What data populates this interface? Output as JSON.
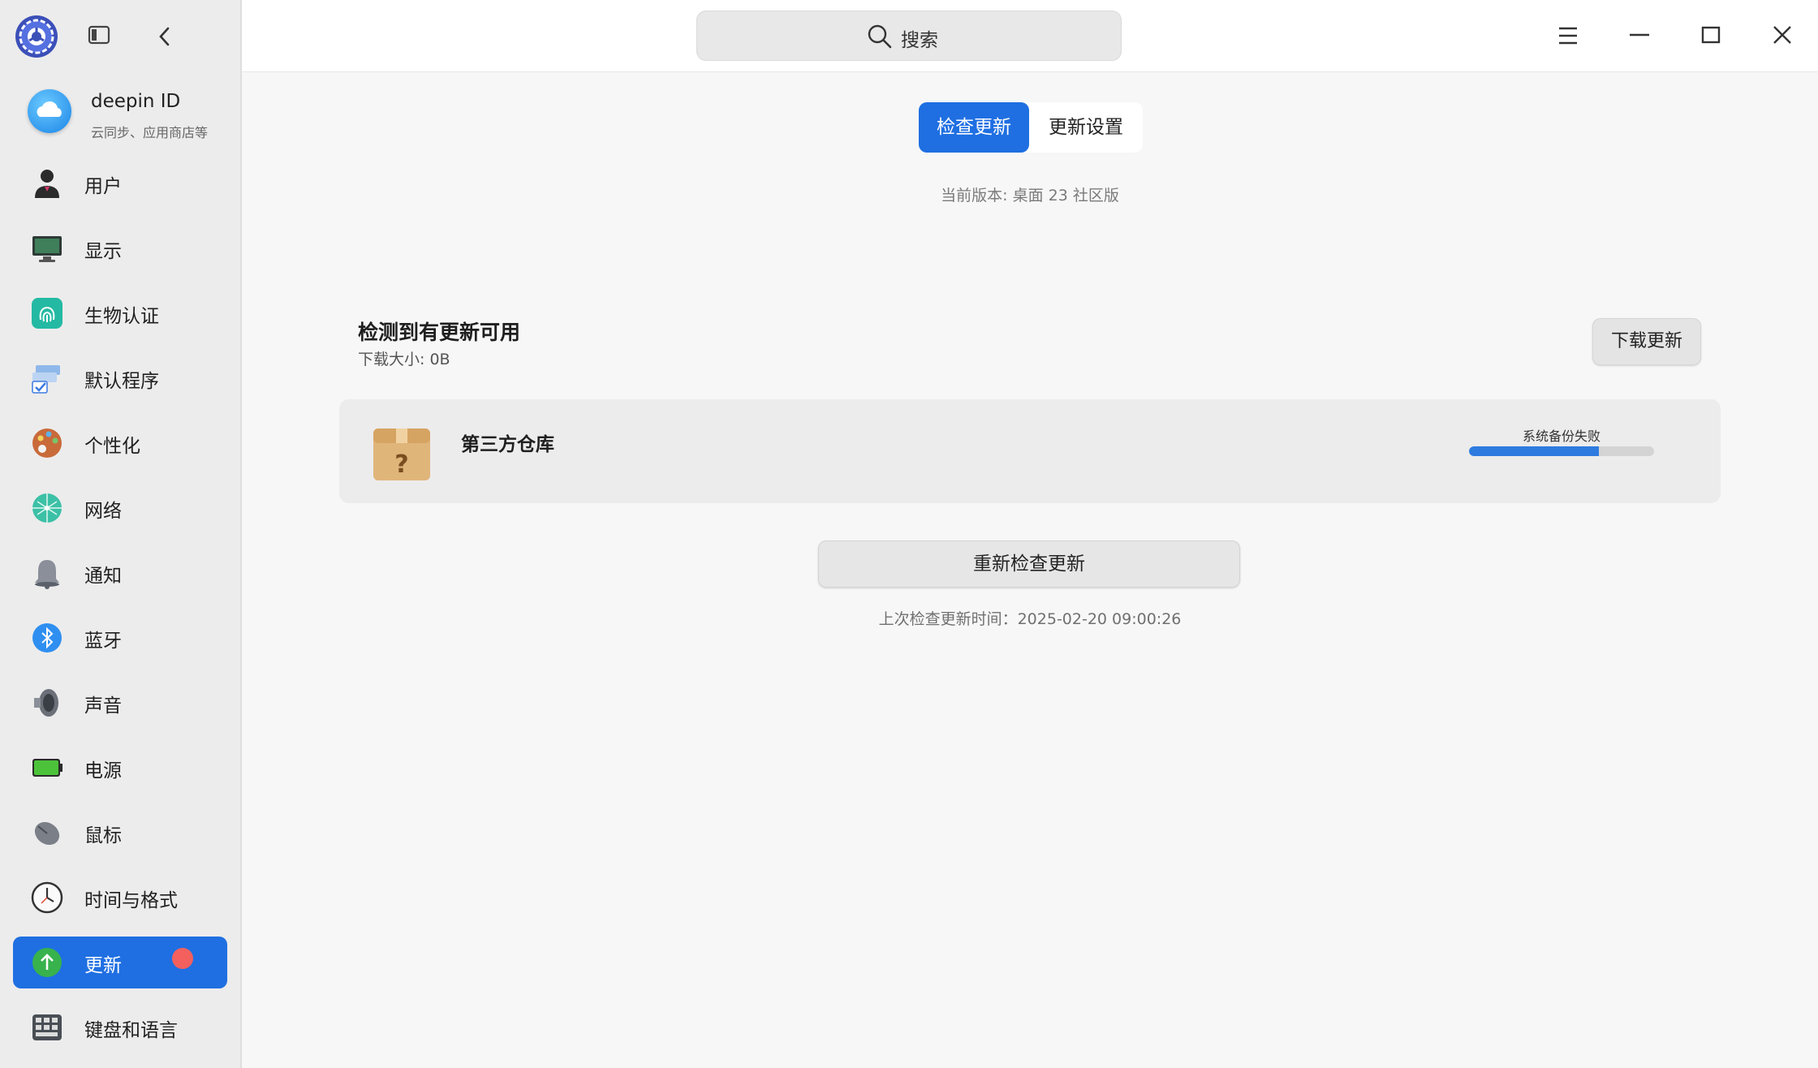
{
  "sidebar": {
    "account": {
      "name": "deepin ID",
      "subtitle": "云同步、应用商店等"
    },
    "items": [
      {
        "label": "用户",
        "icon": "user-icon"
      },
      {
        "label": "显示",
        "icon": "display-icon"
      },
      {
        "label": "生物认证",
        "icon": "fingerprint-icon"
      },
      {
        "label": "默认程序",
        "icon": "default-apps-icon"
      },
      {
        "label": "个性化",
        "icon": "palette-icon"
      },
      {
        "label": "网络",
        "icon": "network-icon"
      },
      {
        "label": "通知",
        "icon": "bell-icon"
      },
      {
        "label": "蓝牙",
        "icon": "bluetooth-icon"
      },
      {
        "label": "声音",
        "icon": "speaker-icon"
      },
      {
        "label": "电源",
        "icon": "battery-icon"
      },
      {
        "label": "鼠标",
        "icon": "mouse-icon"
      },
      {
        "label": "时间与格式",
        "icon": "clock-icon"
      },
      {
        "label": "更新",
        "icon": "update-arrow-icon",
        "active": true,
        "badge": true
      },
      {
        "label": "键盘和语言",
        "icon": "keyboard-icon"
      }
    ]
  },
  "search": {
    "placeholder": "搜索"
  },
  "tabs": {
    "check": "检查更新",
    "settings": "更新设置"
  },
  "version": {
    "text": "当前版本: 桌面 23 社区版"
  },
  "updates": {
    "title": "检测到有更新可用",
    "size": "下载大小: 0B",
    "download_label": "下载更新",
    "repo": {
      "name": "第三方仓库",
      "status": "系统备份失败",
      "progress_fraction": 0.7
    }
  },
  "recheck": {
    "label": "重新检查更新"
  },
  "last_check": {
    "text": "上次检查更新时间：2025-02-20 09:00:26"
  },
  "colors": {
    "accent": "#1f6fe2",
    "badge": "#f3605e",
    "progress": "#2e7be0"
  }
}
